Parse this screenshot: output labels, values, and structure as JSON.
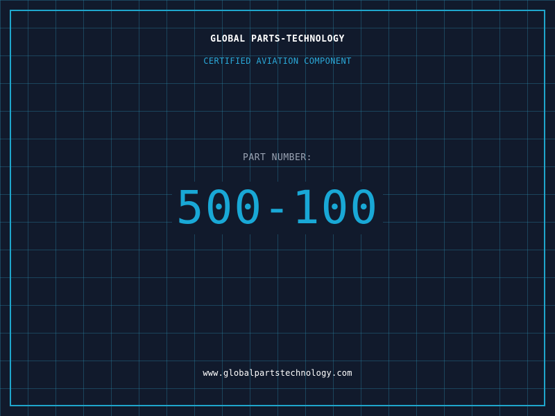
{
  "brand": {
    "name": "GLOBAL PARTS-TECHNOLOGY",
    "tagline": "CERTIFIED AVIATION COMPONENT"
  },
  "part": {
    "label": "PART NUMBER:",
    "number": "500-100"
  },
  "footer": {
    "website": "www.globalpartstechnology.com"
  },
  "colors": {
    "background": "#111a2c",
    "grid": "#2a8aaa",
    "frame": "#1fa6cc",
    "accent": "#19a8d6",
    "label": "#9aa3b3",
    "text": "#ffffff"
  }
}
